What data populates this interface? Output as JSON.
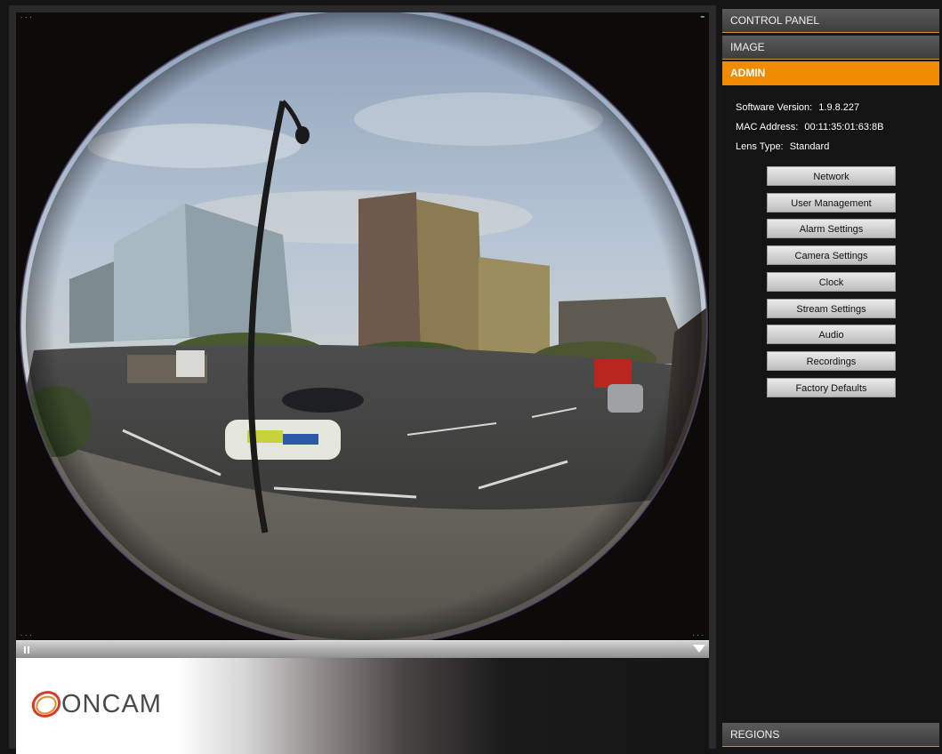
{
  "video": {
    "corner_top_left": "...",
    "corner_top_right": "▬",
    "corner_bottom_left": "...",
    "corner_bottom_right": "..."
  },
  "playbar": {
    "pause_icon": "pause-icon",
    "menu_icon": "chevron-down-icon"
  },
  "logo": {
    "text": "ONCAM",
    "accent": "#d63a2a"
  },
  "panel": {
    "control_panel": "CONTROL PANEL",
    "image": "IMAGE",
    "admin": "ADMIN",
    "regions": "REGIONS"
  },
  "info": {
    "software_label": "Software Version:",
    "software_value": "1.9.8.227",
    "mac_label": "MAC Address:",
    "mac_value": "00:11:35:01:63:8B",
    "lens_label": "Lens Type:",
    "lens_value": "Standard"
  },
  "buttons": [
    "Network",
    "User Management",
    "Alarm Settings",
    "Camera Settings",
    "Clock",
    "Stream Settings",
    "Audio",
    "Recordings",
    "Factory Defaults"
  ],
  "colors": {
    "active_tab": "#f08a00",
    "panel_bg": "#141414"
  }
}
